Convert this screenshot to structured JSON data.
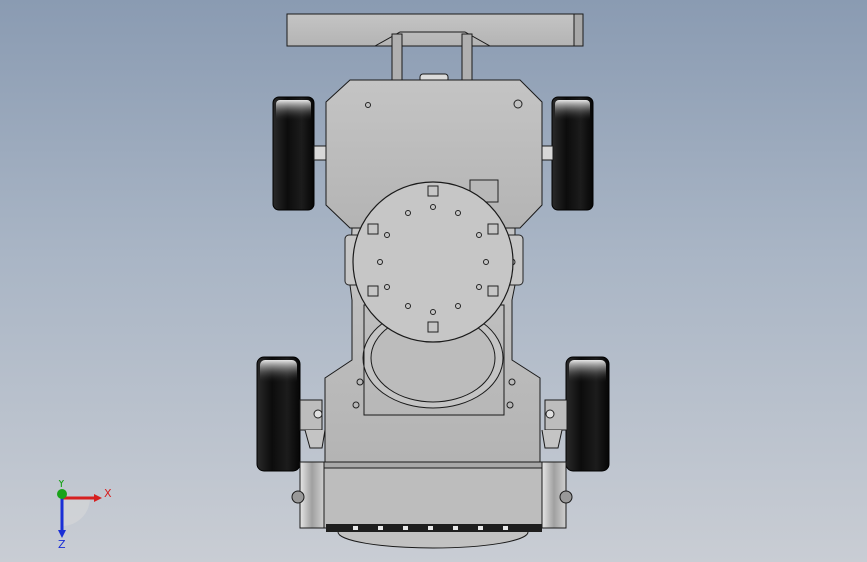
{
  "viewport": {
    "background_top": "#8a9bb2",
    "background_bottom": "#c9cdd4"
  },
  "model": {
    "body_color": "#bdbdbd",
    "edge_color": "#1a1a1a",
    "wheel_color": "#111111"
  },
  "triad": {
    "x_label": "X",
    "y_label": "Y",
    "z_label": "Z",
    "x_color": "#d62020",
    "y_color": "#1aa31a",
    "z_color": "#1a2fd6"
  }
}
